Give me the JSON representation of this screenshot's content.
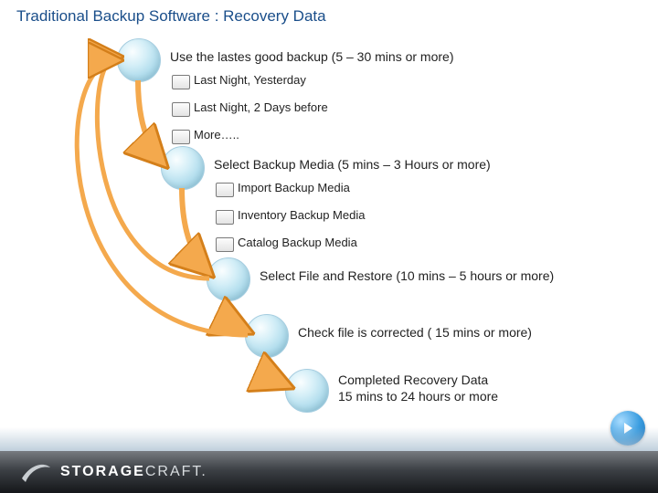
{
  "title": "Traditional Backup Software : Recovery Data",
  "steps": [
    {
      "label": "Use the lastes good backup (5 – 30 mins or more)",
      "subs": [
        "Last Night, Yesterday",
        "Last Night, 2 Days before",
        "More….."
      ]
    },
    {
      "label": "Select Backup Media (5 mins – 3 Hours or more)",
      "subs": [
        "Import Backup Media",
        "Inventory Backup Media",
        "Catalog Backup Media"
      ]
    },
    {
      "label": "Select File and Restore (10 mins – 5 hours or more)",
      "subs": []
    },
    {
      "label": "Check file is corrected ( 15 mins or more)",
      "subs": []
    },
    {
      "label": "Completed Recovery Data",
      "subs": []
    }
  ],
  "final_sub": "15 mins to 24 hours or more",
  "brand": {
    "part1": "STORAGE",
    "part2": "CRAFT"
  },
  "colors": {
    "arrow_fill": "#f4a94d",
    "arrow_stroke": "#d47f1a"
  }
}
